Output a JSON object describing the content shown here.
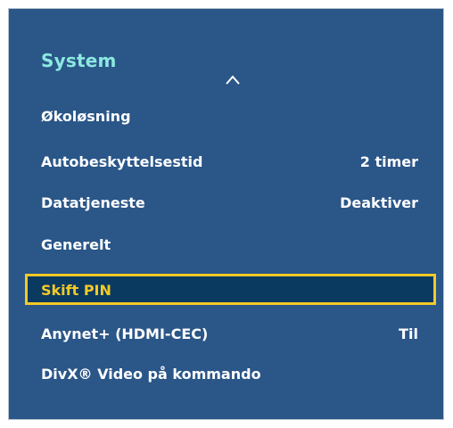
{
  "menu": {
    "title": "System",
    "scroll_up_icon": "chevron-up-icon",
    "items": [
      {
        "label": "Økoløsning",
        "value": ""
      },
      {
        "label": "Autobeskyttelsestid",
        "value": "2 timer"
      },
      {
        "label": "Datatjeneste",
        "value": "Deaktiver"
      },
      {
        "label": "Generelt",
        "value": ""
      },
      {
        "label": "Skift PIN",
        "value": "",
        "selected": true
      },
      {
        "label": "Anynet+ (HDMI-CEC)",
        "value": "Til"
      },
      {
        "label": "DivX® Video på kommando",
        "value": ""
      }
    ]
  },
  "colors": {
    "panel_background": "#2a5688",
    "title": "#8ce8e0",
    "item_text": "#ffffff",
    "selection_border": "#f2ca27",
    "selection_background": "#0b3a60",
    "selection_text": "#f2ca27"
  }
}
